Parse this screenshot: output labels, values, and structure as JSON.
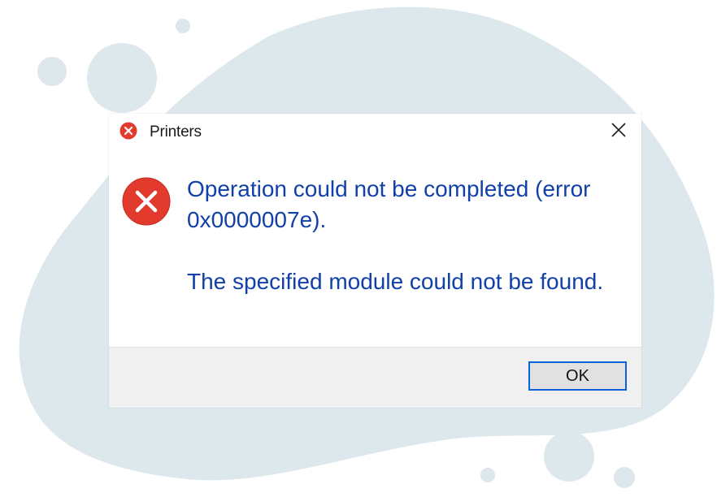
{
  "dialog": {
    "title": "Printers",
    "title_icon": "error-icon",
    "close_icon": "close-icon",
    "message_icon": "error-icon",
    "message_line1": "Operation could not be completed (error 0x0000007e).",
    "message_line2": "The specified module could not be found.",
    "ok_label": "OK"
  },
  "colors": {
    "background_blob": "#dde8ec",
    "message_text": "#1140a8",
    "error_red": "#e23b2e",
    "footer_bg": "#f0f0f0",
    "ok_border": "#0a64d8"
  }
}
